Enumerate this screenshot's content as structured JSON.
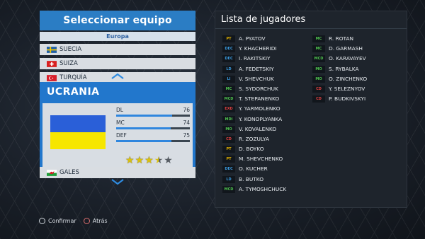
{
  "left_panel": {
    "title": "Seleccionar equipo",
    "region": "Europa",
    "countries_above": [
      {
        "name": "SUECIA",
        "flag": "sweden-flag-icon"
      },
      {
        "name": "SUIZA",
        "flag": "switzerland-flag-icon"
      },
      {
        "name": "TURQUÍA",
        "flag": "turkey-flag-icon"
      }
    ],
    "selected": {
      "name": "UCRANIA",
      "flag_colors": [
        "#2a5fd8",
        "#f6e600"
      ],
      "stats": [
        {
          "label": "DL",
          "value": 76
        },
        {
          "label": "MC",
          "value": 74
        },
        {
          "label": "DEF",
          "value": 75
        }
      ],
      "stars": 3.5,
      "stars_max": 5
    },
    "countries_below": [
      {
        "name": "GALES",
        "flag": "wales-flag-icon"
      }
    ]
  },
  "right_panel": {
    "title": "Lista de jugadores",
    "players_left": [
      {
        "pos": "PT",
        "name": "A. PYATOV",
        "color": "#e6b400"
      },
      {
        "pos": "DEC",
        "name": "Y. KHACHERIDI",
        "color": "#3a9be0"
      },
      {
        "pos": "DEC",
        "name": "I. RAKITSKIY",
        "color": "#3a9be0"
      },
      {
        "pos": "LD",
        "name": "A. FEDETSKIY",
        "color": "#3a9be0"
      },
      {
        "pos": "LI",
        "name": "V. SHEVCHUK",
        "color": "#3a9be0"
      },
      {
        "pos": "MC",
        "name": "S. SYDORCHUK",
        "color": "#4ec24e"
      },
      {
        "pos": "MCD",
        "name": "T. STEPANENKO",
        "color": "#4ec24e"
      },
      {
        "pos": "EXD",
        "name": "Y. YARMOLENKO",
        "color": "#e04040"
      },
      {
        "pos": "MDI",
        "name": "Y. KONOPLYANKA",
        "color": "#4ec24e"
      },
      {
        "pos": "MO",
        "name": "V. KOVALENKO",
        "color": "#4ec24e"
      },
      {
        "pos": "CD",
        "name": "R. ZOZULYA",
        "color": "#e04040"
      },
      {
        "pos": "PT",
        "name": "D. BOYKO",
        "color": "#e6b400"
      },
      {
        "pos": "PT",
        "name": "M. SHEVCHENKO",
        "color": "#e6b400"
      },
      {
        "pos": "DEC",
        "name": "O. KUCHER",
        "color": "#3a9be0"
      },
      {
        "pos": "LD",
        "name": "B. BUTKO",
        "color": "#3a9be0"
      },
      {
        "pos": "MCD",
        "name": "A. TYMOSHCHUCK",
        "color": "#4ec24e"
      }
    ],
    "players_right": [
      {
        "pos": "MC",
        "name": "R. ROTAN",
        "color": "#4ec24e"
      },
      {
        "pos": "MC",
        "name": "D. GARMASH",
        "color": "#4ec24e"
      },
      {
        "pos": "MCD",
        "name": "O. KARAVAYEV",
        "color": "#4ec24e"
      },
      {
        "pos": "MO",
        "name": "S. RYBALKA",
        "color": "#4ec24e"
      },
      {
        "pos": "MO",
        "name": "O. ZINCHENKO",
        "color": "#4ec24e"
      },
      {
        "pos": "CD",
        "name": "Y. SELEZNYOV",
        "color": "#e04040"
      },
      {
        "pos": "CD",
        "name": "P. BUDKIVSKYI",
        "color": "#e04040"
      }
    ]
  },
  "footer": {
    "confirm_label": "Confirmar",
    "back_label": "Atrás"
  }
}
